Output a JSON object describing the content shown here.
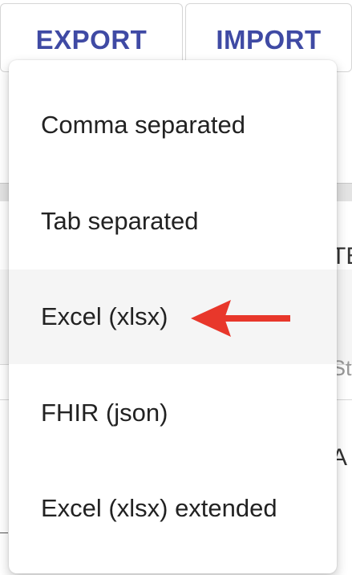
{
  "toolbar": {
    "export_label": "EXPORT",
    "import_label": "IMPORT"
  },
  "background": {
    "fragment_1": "TE",
    "fragment_2": "Sta",
    "fragment_3": "A"
  },
  "export_menu": {
    "items": [
      {
        "label": "Comma separated"
      },
      {
        "label": "Tab separated"
      },
      {
        "label": "Excel (xlsx)"
      },
      {
        "label": "FHIR (json)"
      },
      {
        "label": "Excel (xlsx) extended"
      }
    ],
    "highlighted_item": "Excel (xlsx)"
  },
  "annotation": {
    "icon": "arrow-left-icon",
    "color": "#e8372b"
  },
  "colors": {
    "accent": "#3f4aa4",
    "menu_text": "#222222",
    "highlight_bg": "#f5f5f5"
  }
}
